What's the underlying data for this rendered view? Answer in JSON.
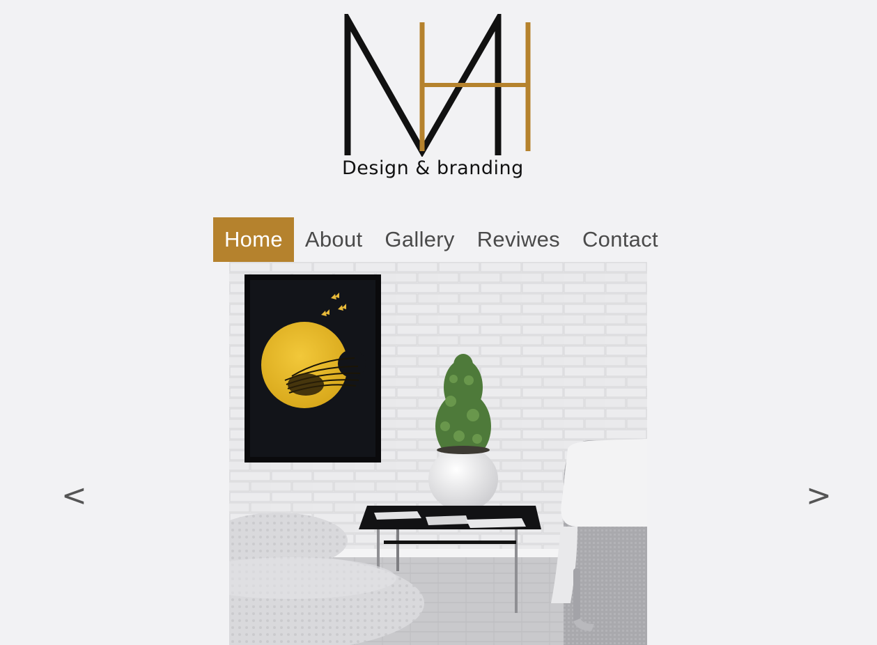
{
  "brand": {
    "logo_letters": "NVH",
    "tagline": "Design & branding",
    "colors": {
      "accent": "#b5822d",
      "dark": "#111111",
      "background": "#f2f2f4"
    }
  },
  "nav": {
    "items": [
      {
        "label": "Home",
        "active": true
      },
      {
        "label": "About",
        "active": false
      },
      {
        "label": "Gallery",
        "active": false
      },
      {
        "label": "Reviwes",
        "active": false
      },
      {
        "label": "Contact",
        "active": false
      }
    ]
  },
  "carousel": {
    "prev_label": "<",
    "next_label": ">",
    "prev_icon": "chevron-left-icon",
    "next_icon": "chevron-right-icon"
  }
}
